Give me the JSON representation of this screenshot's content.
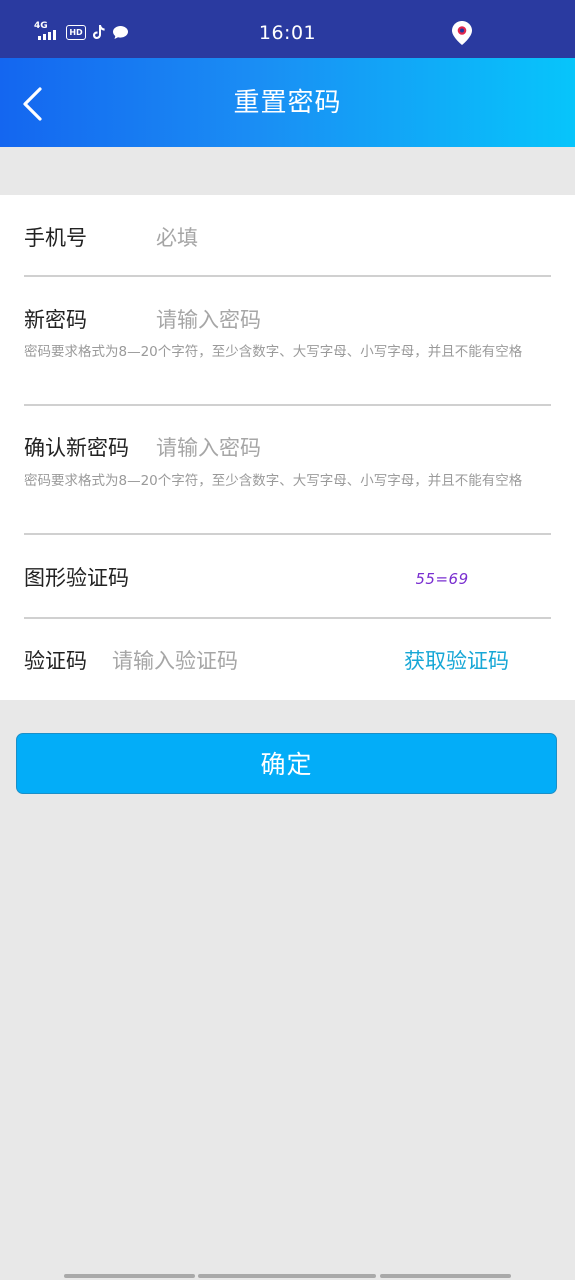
{
  "status_bar": {
    "network": "4G",
    "hd": "HD",
    "time": "16:01"
  },
  "header": {
    "title": "重置密码"
  },
  "form": {
    "phone": {
      "label": "手机号",
      "placeholder": "必填"
    },
    "new_password": {
      "label": "新密码",
      "placeholder": "请输入密码",
      "hint": "密码要求格式为8—20个字符，至少含数字、大写字母、小写字母，并且不能有空格"
    },
    "confirm_password": {
      "label": "确认新密码",
      "placeholder": "请输入密码",
      "hint": "密码要求格式为8—20个字符，至少含数字、大写字母、小写字母，并且不能有空格"
    },
    "captcha": {
      "label": "图形验证码",
      "image_text": "55=69"
    },
    "verification_code": {
      "label": "验证码",
      "placeholder": "请输入验证码",
      "get_code_label": "获取验证码"
    }
  },
  "confirm_button": {
    "label": "确定"
  },
  "colors": {
    "status_bar": "#2a3aa0",
    "header_start": "#1466f0",
    "header_end": "#07c5fb",
    "primary_button": "#03adf8",
    "link": "#17a7d6",
    "captcha_text": "#8a2be2"
  }
}
